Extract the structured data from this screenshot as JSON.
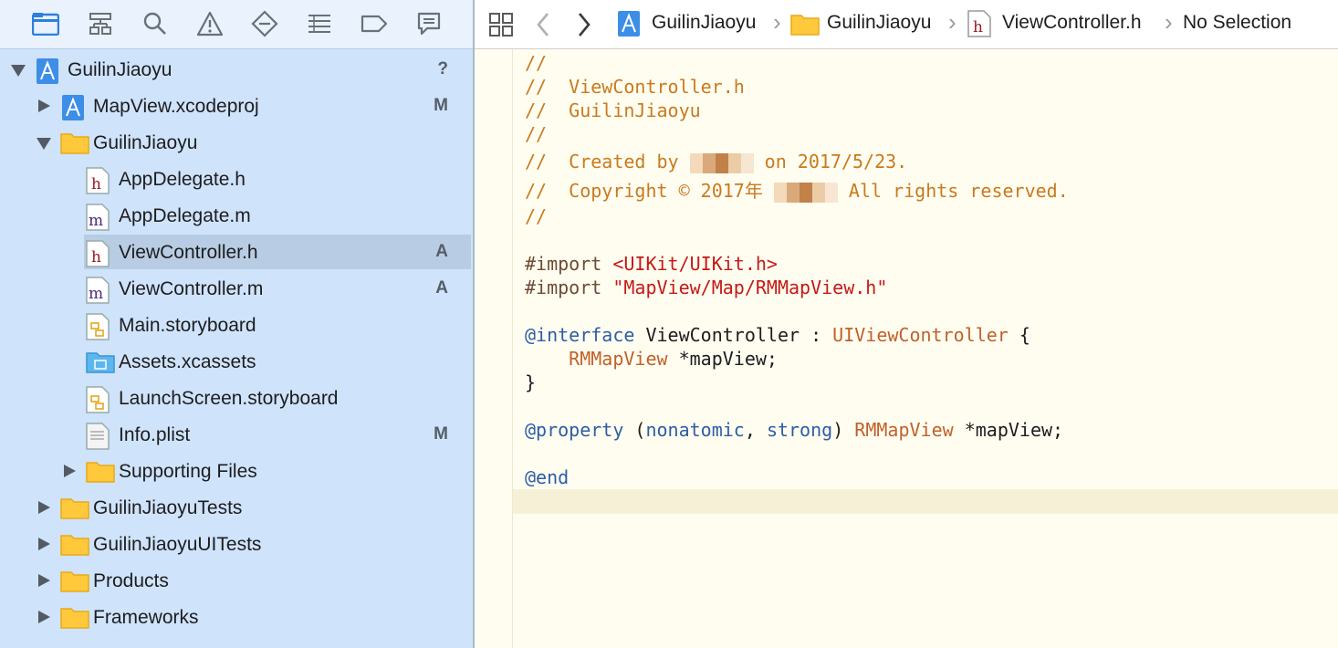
{
  "navigator": {
    "toolbar_icons": [
      "folder-icon",
      "hierarchy-icon",
      "search-icon",
      "warning-icon",
      "test-diamond-icon",
      "list-icon",
      "tag-icon",
      "comment-icon"
    ],
    "tree": [
      {
        "label": "GuilinJiaoyu",
        "type": "project",
        "expanded": true,
        "badge": "?"
      },
      {
        "label": "MapView.xcodeproj",
        "type": "project",
        "expanded": false,
        "badge": "M"
      },
      {
        "label": "GuilinJiaoyu",
        "type": "folder",
        "expanded": true,
        "badge": ""
      },
      {
        "label": "AppDelegate.h",
        "type": "h-file",
        "badge": ""
      },
      {
        "label": "AppDelegate.m",
        "type": "m-file",
        "badge": ""
      },
      {
        "label": "ViewController.h",
        "type": "h-file",
        "badge": "A",
        "selected": true
      },
      {
        "label": "ViewController.m",
        "type": "m-file",
        "badge": "A"
      },
      {
        "label": "Main.storyboard",
        "type": "storyboard",
        "badge": ""
      },
      {
        "label": "Assets.xcassets",
        "type": "assets",
        "badge": ""
      },
      {
        "label": "LaunchScreen.storyboard",
        "type": "storyboard",
        "badge": ""
      },
      {
        "label": "Info.plist",
        "type": "plist",
        "badge": "M"
      },
      {
        "label": "Supporting Files",
        "type": "folder",
        "expanded": false,
        "badge": ""
      },
      {
        "label": "GuilinJiaoyuTests",
        "type": "folder",
        "expanded": false,
        "badge": ""
      },
      {
        "label": "GuilinJiaoyuUITests",
        "type": "folder",
        "expanded": false,
        "badge": ""
      },
      {
        "label": "Products",
        "type": "folder",
        "expanded": false,
        "badge": ""
      },
      {
        "label": "Frameworks",
        "type": "folder",
        "expanded": false,
        "badge": ""
      }
    ]
  },
  "jumpbar": {
    "crumbs": [
      "GuilinJiaoyu",
      "GuilinJiaoyu",
      "ViewController.h",
      "No Selection"
    ]
  },
  "editor": {
    "lines": {
      "l1": "//",
      "l2": "//  ViewController.h",
      "l3": "//  GuilinJiaoyu",
      "l4": "//",
      "l5a": "//  Created by ",
      "l5b": " on 2017/5/23.",
      "l6a": "//  Copyright © 2017年 ",
      "l6b": " All rights reserved.",
      "l7": "//",
      "imp1_dir": "#import ",
      "imp1_path": "<UIKit/UIKit.h>",
      "imp2_dir": "#import ",
      "imp2_path": "\"MapView/Map/RMMapView.h\"",
      "intf_kw": "@interface",
      "intf_name": " ViewController : ",
      "intf_super": "UIViewController",
      "intf_brace": " {",
      "ivar_type": "RMMapView",
      "ivar_name": " *mapView;",
      "close_brace": "}",
      "prop_kw": "@property",
      "prop_open": " (",
      "prop_attr1": "nonatomic",
      "prop_comma": ", ",
      "prop_attr2": "strong",
      "prop_close": ") ",
      "prop_type": "RMMapView",
      "prop_name": " *mapView;",
      "end_kw": "@end"
    }
  }
}
